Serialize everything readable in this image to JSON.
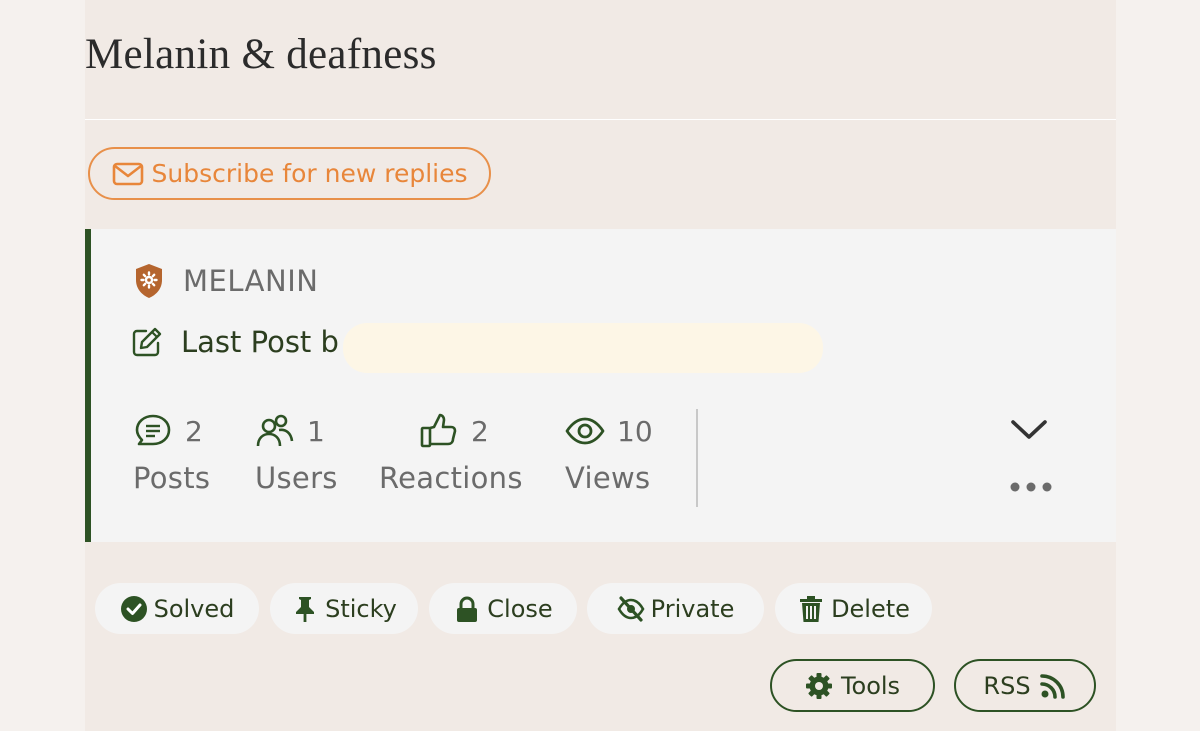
{
  "topic": {
    "title": "Melanin & deafness"
  },
  "subscribe": {
    "label": "Subscribe for new replies",
    "color": "#e8863a"
  },
  "forum": {
    "name": "MELANIN",
    "badge_color": "#b5652e"
  },
  "last_post": {
    "label": "Last Post b"
  },
  "stats": [
    {
      "icon": "posts-icon",
      "value": "2",
      "label": "Posts"
    },
    {
      "icon": "users-icon",
      "value": "1",
      "label": "Users"
    },
    {
      "icon": "thumbs-up-icon",
      "value": "2",
      "label": "Reactions"
    },
    {
      "icon": "eye-icon",
      "value": "10",
      "label": "Views"
    }
  ],
  "actions": [
    {
      "icon": "check-circle-icon",
      "label": "Solved"
    },
    {
      "icon": "pin-icon",
      "label": "Sticky"
    },
    {
      "icon": "lock-icon",
      "label": "Close"
    },
    {
      "icon": "eye-slash-icon",
      "label": "Private"
    },
    {
      "icon": "trash-icon",
      "label": "Delete"
    }
  ],
  "toolbar": {
    "tools_label": "Tools",
    "rss_label": "RSS"
  },
  "colors": {
    "accent_green": "#2d5224",
    "accent_orange": "#e8904a",
    "card_bg": "#f4f4f4",
    "page_bg": "#f1eae5"
  }
}
